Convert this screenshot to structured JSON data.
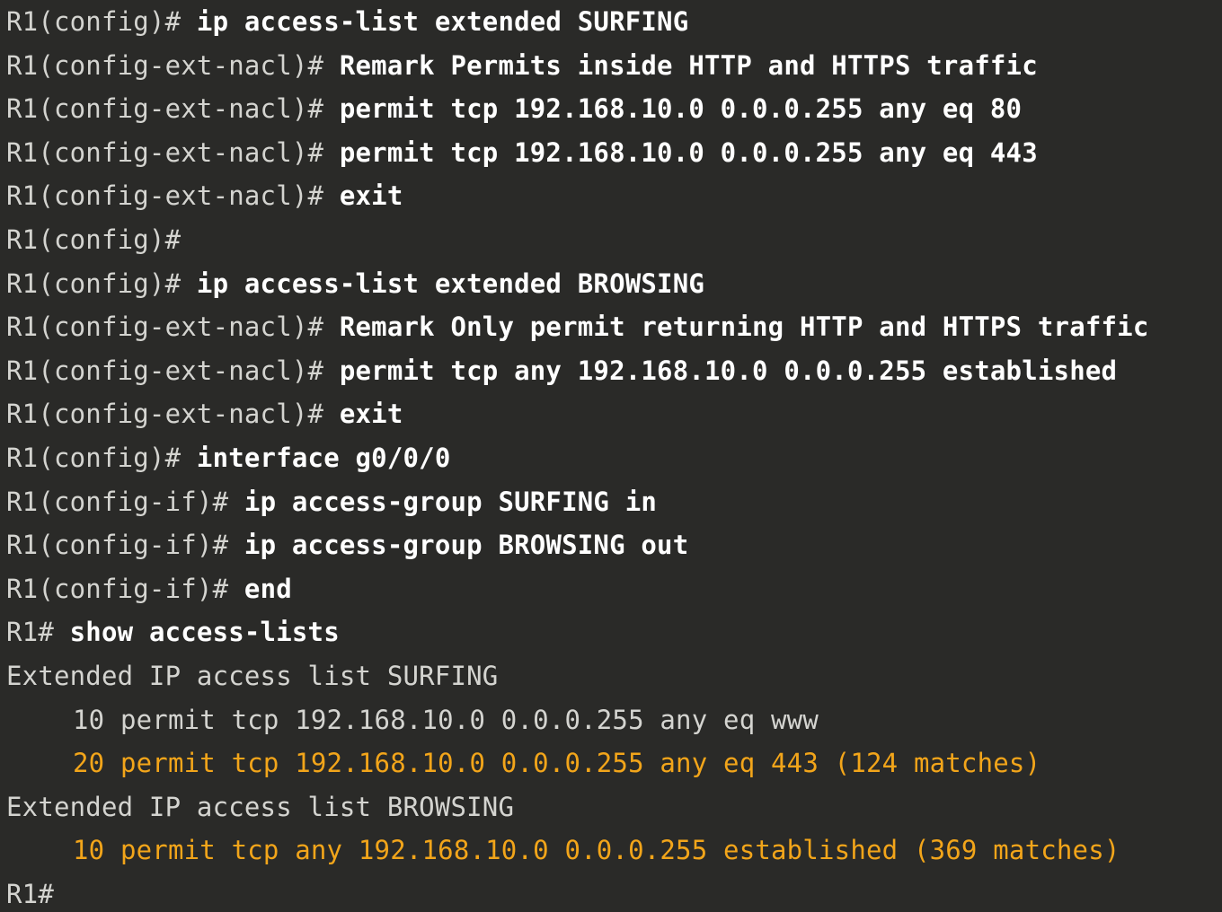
{
  "terminal": {
    "colors": {
      "background": "#2a2a28",
      "prompt": "#d4d4d0",
      "command": "#ffffff",
      "output": "#d4d4d0",
      "highlight": "#f2a51a"
    },
    "lines": [
      {
        "prompt": "R1(config)# ",
        "command": "ip access-list extended SURFING"
      },
      {
        "prompt": "R1(config-ext-nacl)# ",
        "command": "Remark Permits inside HTTP and HTTPS traffic"
      },
      {
        "prompt": "R1(config-ext-nacl)# ",
        "command": "permit tcp 192.168.10.0 0.0.0.255 any eq 80"
      },
      {
        "prompt": "R1(config-ext-nacl)# ",
        "command": "permit tcp 192.168.10.0 0.0.0.255 any eq 443"
      },
      {
        "prompt": "R1(config-ext-nacl)# ",
        "command": "exit"
      },
      {
        "prompt": "R1(config)#",
        "command": ""
      },
      {
        "prompt": "R1(config)# ",
        "command": "ip access-list extended BROWSING"
      },
      {
        "prompt": "R1(config-ext-nacl)# ",
        "command": "Remark Only permit returning HTTP and HTTPS traffic"
      },
      {
        "prompt": "R1(config-ext-nacl)# ",
        "command": "permit tcp any 192.168.10.0 0.0.0.255 established"
      },
      {
        "prompt": "R1(config-ext-nacl)# ",
        "command": "exit"
      },
      {
        "prompt": "R1(config)# ",
        "command": "interface g0/0/0"
      },
      {
        "prompt": "R1(config-if)# ",
        "command": "ip access-group SURFING in"
      },
      {
        "prompt": "R1(config-if)# ",
        "command": "ip access-group BROWSING out"
      },
      {
        "prompt": "R1(config-if)# ",
        "command": "end"
      },
      {
        "prompt": "R1# ",
        "command": "show access-lists"
      },
      {
        "output": "Extended IP access list SURFING"
      },
      {
        "entry": "10 permit tcp 192.168.10.0 0.0.0.255 any eq www"
      },
      {
        "highlight": "20 permit tcp 192.168.10.0 0.0.0.255 any eq 443 (124 matches)"
      },
      {
        "output": "Extended IP access list BROWSING"
      },
      {
        "highlight": "10 permit tcp any 192.168.10.0 0.0.0.255 established (369 matches)"
      },
      {
        "prompt": "R1#",
        "command": ""
      }
    ]
  }
}
